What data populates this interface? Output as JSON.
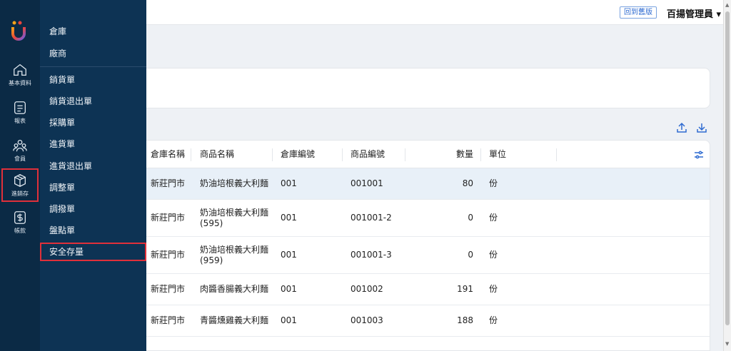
{
  "rail": {
    "items": [
      {
        "label": "基本資料",
        "icon": "home-icon"
      },
      {
        "label": "報表",
        "icon": "report-icon"
      },
      {
        "label": "會員",
        "icon": "members-icon"
      },
      {
        "label": "進銷存",
        "icon": "box-icon"
      },
      {
        "label": "帳款",
        "icon": "dollar-icon"
      }
    ],
    "selected": "進銷存"
  },
  "submenu": {
    "items": [
      "倉庫",
      "廠商",
      "銷貨單",
      "銷貨退出單",
      "採購單",
      "進貨單",
      "進貨退出單",
      "調整單",
      "調撥單",
      "盤點單",
      "安全存量"
    ],
    "selected": "安全存量"
  },
  "header": {
    "old_version_label": "回到舊版",
    "user": "百揚管理員 ▾"
  },
  "table": {
    "columns": [
      "倉庫名稱",
      "商品名稱",
      "倉庫編號",
      "商品編號",
      "數量",
      "單位"
    ],
    "rows": [
      {
        "warehouse": "新莊門市",
        "product": "奶油培根義大利麵",
        "wh_no": "001",
        "product_no": "001001",
        "qty": "80",
        "unit": "份"
      },
      {
        "warehouse": "新莊門市",
        "product": "奶油培根義大利麵\n(595)",
        "wh_no": "001",
        "product_no": "001001-2",
        "qty": "0",
        "unit": "份"
      },
      {
        "warehouse": "新莊門市",
        "product": "奶油培根義大利麵\n(959)",
        "wh_no": "001",
        "product_no": "001001-3",
        "qty": "0",
        "unit": "份"
      },
      {
        "warehouse": "新莊門市",
        "product": "肉醬香腸義大利麵",
        "wh_no": "001",
        "product_no": "001002",
        "qty": "191",
        "unit": "份"
      },
      {
        "warehouse": "新莊門市",
        "product": "青醬燻雞義大利麵",
        "wh_no": "001",
        "product_no": "001003",
        "qty": "188",
        "unit": "份"
      }
    ]
  },
  "colors": {
    "rail": "#0b2a45",
    "submenu": "#0d3354",
    "accent": "#2e6bd1",
    "highlight": "#e0303a"
  }
}
